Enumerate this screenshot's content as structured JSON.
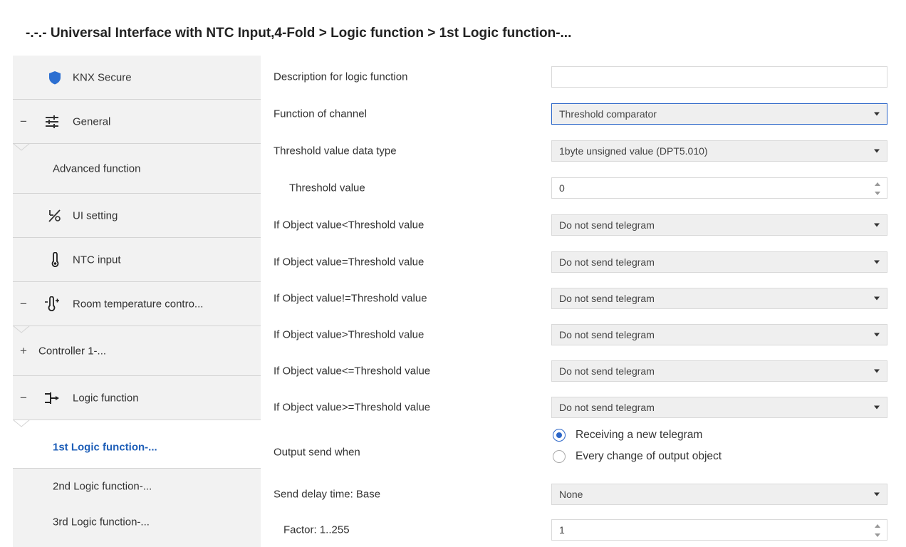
{
  "title": "-.-.- Universal Interface with NTC Input,4-Fold > Logic function > 1st Logic function-...",
  "sidebar": {
    "knx_secure": {
      "label": "KNX Secure",
      "icon": "shield-icon"
    },
    "general": {
      "sign": "−",
      "label": "General",
      "icon": "sliders-icon"
    },
    "advanced": {
      "label": "Advanced function"
    },
    "ui_setting": {
      "label": "UI setting",
      "icon": "ui-setting-icon"
    },
    "ntc_input": {
      "label": "NTC input",
      "icon": "thermometer-icon"
    },
    "room_temp": {
      "sign": "−",
      "label": "Room temperature contro...",
      "icon": "thermometer-icon"
    },
    "controller": {
      "sign": "+",
      "label": "Controller 1-..."
    },
    "logic": {
      "sign": "−",
      "label": "Logic function",
      "icon": "logic-gate-icon"
    },
    "logic_1": {
      "label": "1st Logic function-..."
    },
    "logic_2": {
      "label": "2nd Logic function-..."
    },
    "logic_3": {
      "label": "3rd Logic function-..."
    }
  },
  "params": {
    "description": {
      "label": "Description for logic function",
      "value": ""
    },
    "function_channel": {
      "label": "Function of channel",
      "value": "Threshold comparator"
    },
    "data_type": {
      "label": "Threshold value data type",
      "value": "1byte unsigned value (DPT5.010)"
    },
    "threshold": {
      "label": "Threshold value",
      "value": "0"
    },
    "lt": {
      "label": "If Object value<Threshold value",
      "value": "Do not send telegram"
    },
    "eq": {
      "label": "If Object value=Threshold value",
      "value": "Do not send telegram"
    },
    "ne": {
      "label": "If Object value!=Threshold value",
      "value": "Do not send telegram"
    },
    "gt": {
      "label": "If Object value>Threshold value",
      "value": "Do not send telegram"
    },
    "le": {
      "label": "If Object value<=Threshold value",
      "value": "Do not send telegram"
    },
    "ge": {
      "label": "If Object value>=Threshold value",
      "value": "Do not send telegram"
    },
    "output_send": {
      "label": "Output send when",
      "options": [
        "Receiving a new telegram",
        "Every change of output object"
      ],
      "selected": "Receiving a new telegram"
    },
    "delay_base": {
      "label": "Send delay time: Base",
      "value": "None"
    },
    "factor": {
      "label": "Factor: 1..255",
      "value": "1"
    }
  },
  "colors": {
    "accent": "#1f5fb8",
    "sidebar_bg": "#f2f2f2",
    "select_bg": "#efefef",
    "focus_border": "#2c66c8"
  }
}
